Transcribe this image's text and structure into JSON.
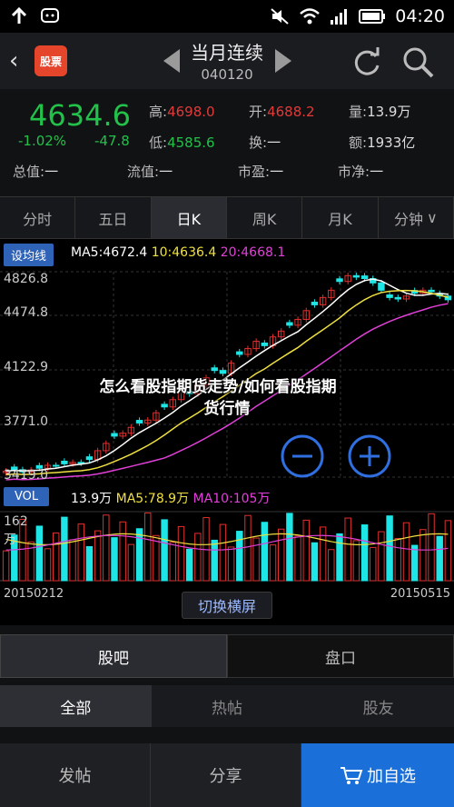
{
  "status": {
    "time": "04:20"
  },
  "header": {
    "back_icon": "back-arrow-icon",
    "logo_text": "股票",
    "name": "当月连续",
    "code": "040120"
  },
  "quote": {
    "price": "4634.6",
    "change_pct": "-1.02%",
    "change": "-47.8",
    "high_label": "高:",
    "high": "4698.0",
    "open_label": "开:",
    "open": "4688.2",
    "vol_label": "量:",
    "vol": "13.9万",
    "low_label": "低:",
    "low": "4585.6",
    "turnover_label": "换:",
    "turnover": "一",
    "amount_label": "额:",
    "amount": "1933亿",
    "mktcap_label": "总值:",
    "mktcap": "一",
    "float_label": "流值:",
    "float": "一",
    "pe_label": "市盈:",
    "pe": "一",
    "pb_label": "市净:",
    "pb": "一"
  },
  "tabs": [
    "分时",
    "五日",
    "日K",
    "周K",
    "月K",
    "分钟"
  ],
  "chart": {
    "setma_label": "设均线",
    "ma5": "MA5:4672.4",
    "ma10": "10:4636.4",
    "ma20": "20:4668.1",
    "y_labels": [
      "4826.8",
      "4474.8",
      "4122.9",
      "3771.0",
      "3419.0"
    ],
    "vol_box": "VOL",
    "vol_val": "13.9万",
    "vol_ma5": "MA5:78.9万",
    "vol_ma10": "MA10:105万",
    "vol_y_top": "162",
    "vol_y_unit": "万",
    "date_start": "20150212",
    "date_end": "20150515",
    "overlay_line1": "怎么看股指期货走势/如何看股指期",
    "overlay_line2": "货行情",
    "switch_label": "切换横屏",
    "colors": {
      "up": "#e0302e",
      "down": "#1ee6e6",
      "ma5": "#ffffff",
      "ma10": "#f0e040",
      "ma20": "#e040d8"
    }
  },
  "chart_data": {
    "type": "bar",
    "title": "",
    "ylim": [
      3419.0,
      4826.8
    ],
    "candles_close": [
      3460,
      3470,
      3455,
      3468,
      3480,
      3500,
      3495,
      3510,
      3520,
      3515,
      3540,
      3600,
      3650,
      3700,
      3720,
      3760,
      3790,
      3810,
      3860,
      3900,
      3950,
      4010,
      3990,
      4050,
      4100,
      4150,
      4130,
      4200,
      4260,
      4300,
      4350,
      4320,
      4380,
      4420,
      4460,
      4500,
      4560,
      4600,
      4650,
      4700,
      4760,
      4800,
      4790,
      4780,
      4750,
      4700,
      4650,
      4640,
      4660,
      4680,
      4700,
      4690,
      4660,
      4634.6
    ],
    "volume_ma_unit": "万",
    "volume_max": 162
  },
  "actions": {
    "seg_left": "股吧",
    "seg_right": "盘口",
    "sub_all": "全部",
    "sub_hot": "热帖",
    "sub_friend": "股友",
    "post": "发帖",
    "share": "分享",
    "add": "加自选"
  }
}
